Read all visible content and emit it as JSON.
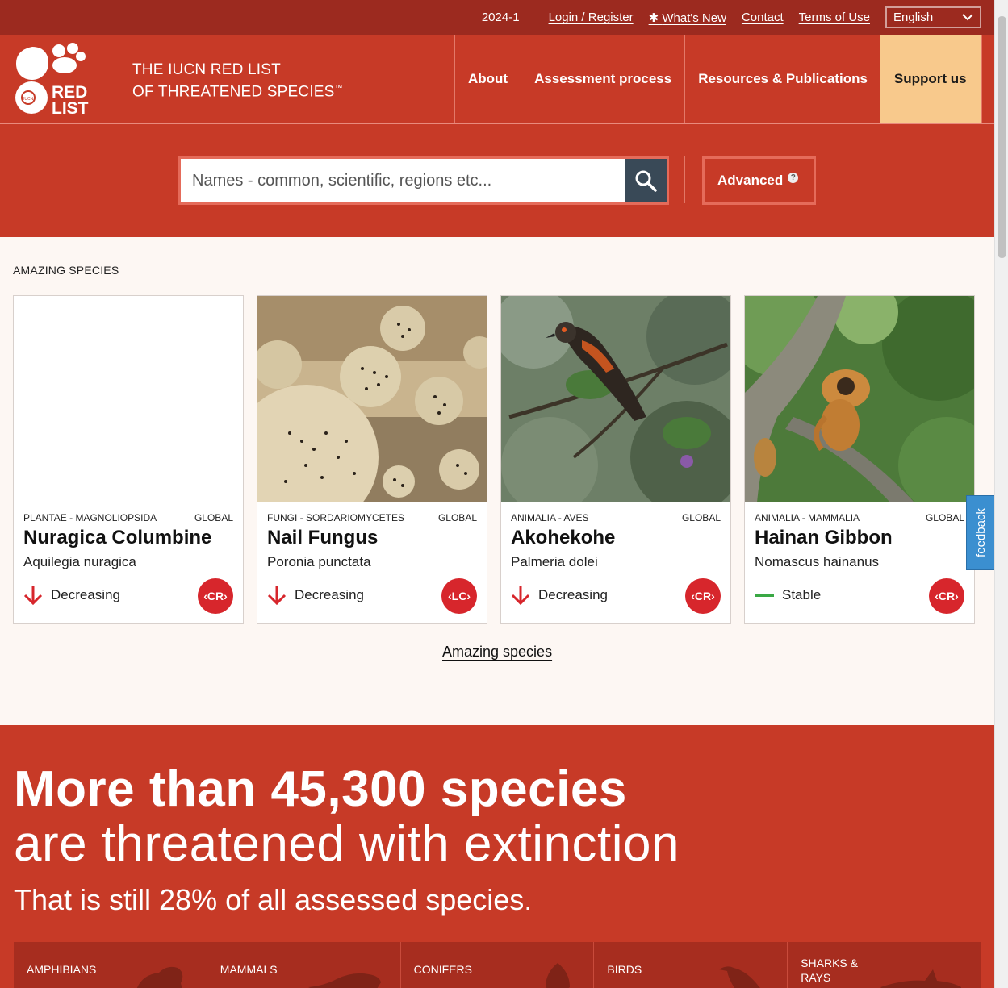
{
  "utility": {
    "version": "2024-1",
    "login": "Login / Register",
    "whats_new": "What's New",
    "contact": "Contact",
    "terms": "Terms of Use",
    "language": "English"
  },
  "header": {
    "logo_text_1": "RED",
    "logo_text_2": "LIST",
    "logo_small": "IUCN",
    "title_line1": "THE IUCN RED LIST",
    "title_line2": "OF THREATENED SPECIES",
    "tm": "™",
    "nav": [
      "About",
      "Assessment process",
      "Resources & Publications",
      "Support us"
    ]
  },
  "search": {
    "placeholder": "Names - common, scientific, regions etc...",
    "advanced": "Advanced",
    "help": "?"
  },
  "amazing": {
    "section_label": "AMAZING SPECIES",
    "link": "Amazing species",
    "cards": [
      {
        "taxonomy": "PLANTAE - MAGNOLIOPSIDA",
        "scope": "GLOBAL",
        "common": "Nuragica Columbine",
        "scientific": "Aquilegia nuragica",
        "trend": "Decreasing",
        "status": "CR"
      },
      {
        "taxonomy": "FUNGI - SORDARIOMYCETES",
        "scope": "GLOBAL",
        "common": "Nail Fungus",
        "scientific": "Poronia punctata",
        "trend": "Decreasing",
        "status": "LC"
      },
      {
        "taxonomy": "ANIMALIA - AVES",
        "scope": "GLOBAL",
        "common": "Akohekohe",
        "scientific": "Palmeria dolei",
        "trend": "Decreasing",
        "status": "CR"
      },
      {
        "taxonomy": "ANIMALIA - MAMMALIA",
        "scope": "GLOBAL",
        "common": "Hainan Gibbon",
        "scientific": "Nomascus hainanus",
        "trend": "Stable",
        "status": "CR"
      }
    ]
  },
  "feedback": "feedback",
  "stats": {
    "headline_bold": "More than 45,300 species",
    "headline": "are threatened with extinction",
    "sub": "That is still 28% of all assessed species.",
    "groups": [
      "AMPHIBIANS",
      "MAMMALS",
      "CONIFERS",
      "BIRDS",
      "SHARKS & RAYS"
    ]
  },
  "colors": {
    "brand_red": "#c73a27",
    "dark_red": "#9c2a1f",
    "support": "#f8c98c",
    "cr_badge": "#d7262c",
    "search_button": "#394957",
    "feedback": "#3b8fd0"
  }
}
